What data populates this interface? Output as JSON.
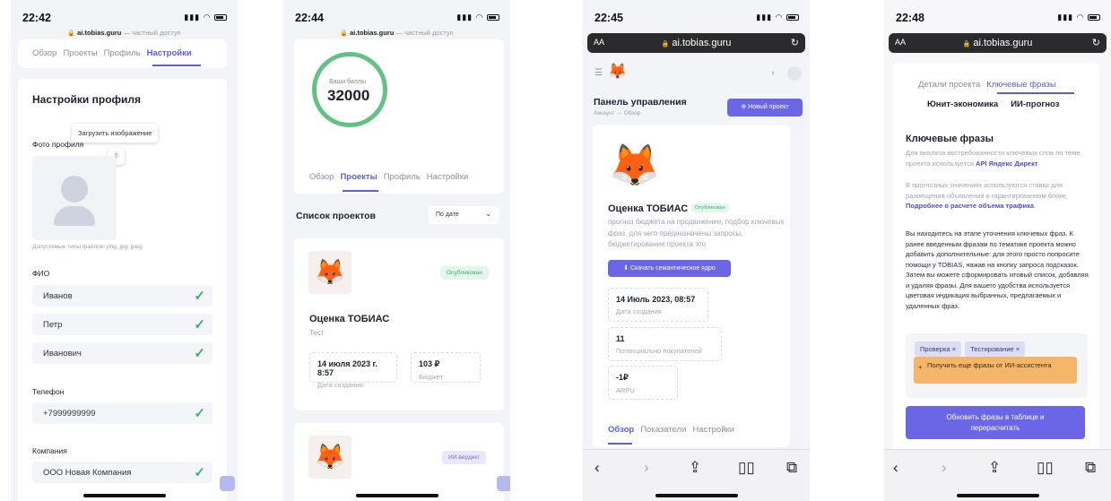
{
  "screens": [
    {
      "time": "22:42",
      "url": {
        "host": "ai.tobias.guru",
        "sub": " — частный доступ"
      },
      "tabs": [
        "Обзор",
        "Проекты",
        "Профиль",
        "Настройки"
      ],
      "active_tab": "Настройки",
      "section_title": "Настройки профиля",
      "tooltip": "Загрузить изображение",
      "photo_label": "Фото профиля",
      "file_types": "Допустимые типы файлов: png, jpg, jpeg.",
      "fio_label": "ФИО",
      "fio": [
        "Иванов",
        "Петр",
        "Иванович"
      ],
      "phone_label": "Телефон",
      "phone": "+7999999999",
      "company_label": "Компания",
      "company": "ООО Новая Компания"
    },
    {
      "time": "22:44",
      "url": {
        "host": "ai.tobias.guru",
        "sub": " — частный доступ"
      },
      "score_label": "Ваши баллы",
      "score": "32000",
      "tabs": [
        "Обзор",
        "Проекты",
        "Профиль",
        "Настройки"
      ],
      "active_tab": "Проекты",
      "list_title": "Список проектов",
      "sort": "По дате",
      "project": {
        "status": "Опубликован",
        "title": "Оценка ТОБИАС",
        "sub": "Тест",
        "date": "14 июля 2023 г. 8:57",
        "date_label": "Дата создания",
        "budget": "103 ₽",
        "budget_label": "Бюджет"
      },
      "project2_status": "ИИ-вердикт"
    },
    {
      "time": "22:45",
      "aa": "AA",
      "host": "ai.tobias.guru",
      "title": "Панель управления",
      "breadcrumb": "Аккаунт → Обзор",
      "new_project": "Новый проект",
      "project_title": "Оценка ТОБИАС",
      "status": "Опубликован",
      "description": "прогноз бюджета на продвижение, подбор ключевых фраз, для чего предназначены запросы, бюджетирование проекта это",
      "download": "Скачать семантическое ядро",
      "stats": [
        {
          "value": "14 Июль 2023, 08:57",
          "label": "Дата создания"
        },
        {
          "value": "11",
          "label": "Потенциально покупателей"
        },
        {
          "value": "-1₽",
          "label": "ARPU"
        }
      ],
      "tabs": [
        "Обзор",
        "Показатели",
        "Настройки"
      ],
      "active_tab": "Обзор"
    },
    {
      "time": "22:48",
      "aa": "AA",
      "host": "ai.tobias.guru",
      "tabs_row1": [
        "Детали проекта",
        "Ключевые фразы"
      ],
      "active_tab": "Ключевые фразы",
      "tabs_row2": [
        "Юнит-экономика",
        "ИИ-прогноз"
      ],
      "section_title": "Ключевые фразы",
      "p1_a": "Для анализа востребованности ключевых слов по теме проекта используется ",
      "p1_link": "API Яндекс Директ",
      "p1_b": ".",
      "p2_a": "В прогнозных значениях используются ставки для размещения объявлений в гарантированном блоке. ",
      "p2_link": "Подробнее о расчете объема трафика",
      "p2_b": ".",
      "p3": "Вы находитесь на этапе уточнения ключевых фраз. К ранее введенным фразам по тематике проекта можно добавить дополнительные: для этого просто попросите помощи у TOBIAS, нажав на кнопку запроса подсказок. Затем вы можете сформировать итовый список, добавляя и удаляя фразы. Для вашего удобства используется цветовая индикация выбранных, предлагаемых и удаленных фраз.",
      "chips": [
        "Проверка ×",
        "Тестирование ×"
      ],
      "ai_button": "Получить еще фразы от ИИ-ассистента",
      "update_button": "Обновить фразы в таблице и перерасчитать"
    }
  ]
}
